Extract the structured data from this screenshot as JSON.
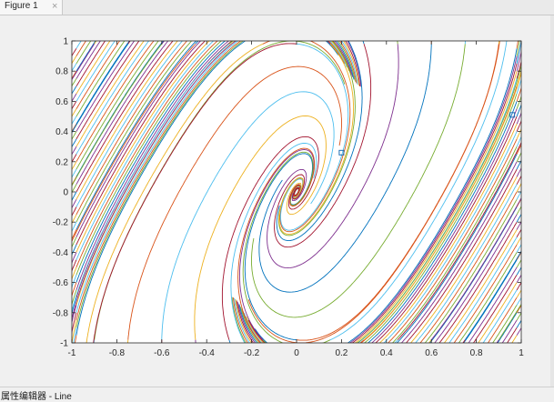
{
  "window": {
    "tab_label": "Figure 1",
    "tab_close": "×",
    "status_text": "属性编辑器 - Line"
  },
  "colors": {
    "axes_background": "#ffffff",
    "figure_background": "#f0f0f0",
    "marker": "#1f6fb5",
    "palette": [
      "#0072BD",
      "#D95319",
      "#EDB120",
      "#7E2F8E",
      "#77AC30",
      "#4DBEEE",
      "#A2142F"
    ]
  },
  "chart_data": {
    "type": "line",
    "description_series": "streamline family of a 2D phase portrait",
    "xlim": [
      -1,
      1
    ],
    "ylim": [
      -1,
      1
    ],
    "x_ticks": [
      -1,
      -0.8,
      -0.6,
      -0.4,
      -0.2,
      0,
      0.2,
      0.4,
      0.6,
      0.8,
      1
    ],
    "y_ticks": [
      -1,
      -0.8,
      -0.6,
      -0.4,
      -0.2,
      0,
      0.2,
      0.4,
      0.6,
      0.8,
      1
    ],
    "x_tick_labels": [
      "-1",
      "-0.8",
      "-0.6",
      "-0.4",
      "-0.2",
      "0",
      "0.2",
      "0.4",
      "0.6",
      "0.8",
      "1"
    ],
    "y_tick_labels": [
      "-1",
      "-0.8",
      "-0.6",
      "-0.4",
      "-0.2",
      "0",
      "0.2",
      "0.4",
      "0.6",
      "0.8",
      "1"
    ],
    "markers": [
      {
        "x": 0.2,
        "y": 0.26
      },
      {
        "x": 0.96,
        "y": 0.51
      }
    ],
    "grid": false,
    "box": true
  }
}
